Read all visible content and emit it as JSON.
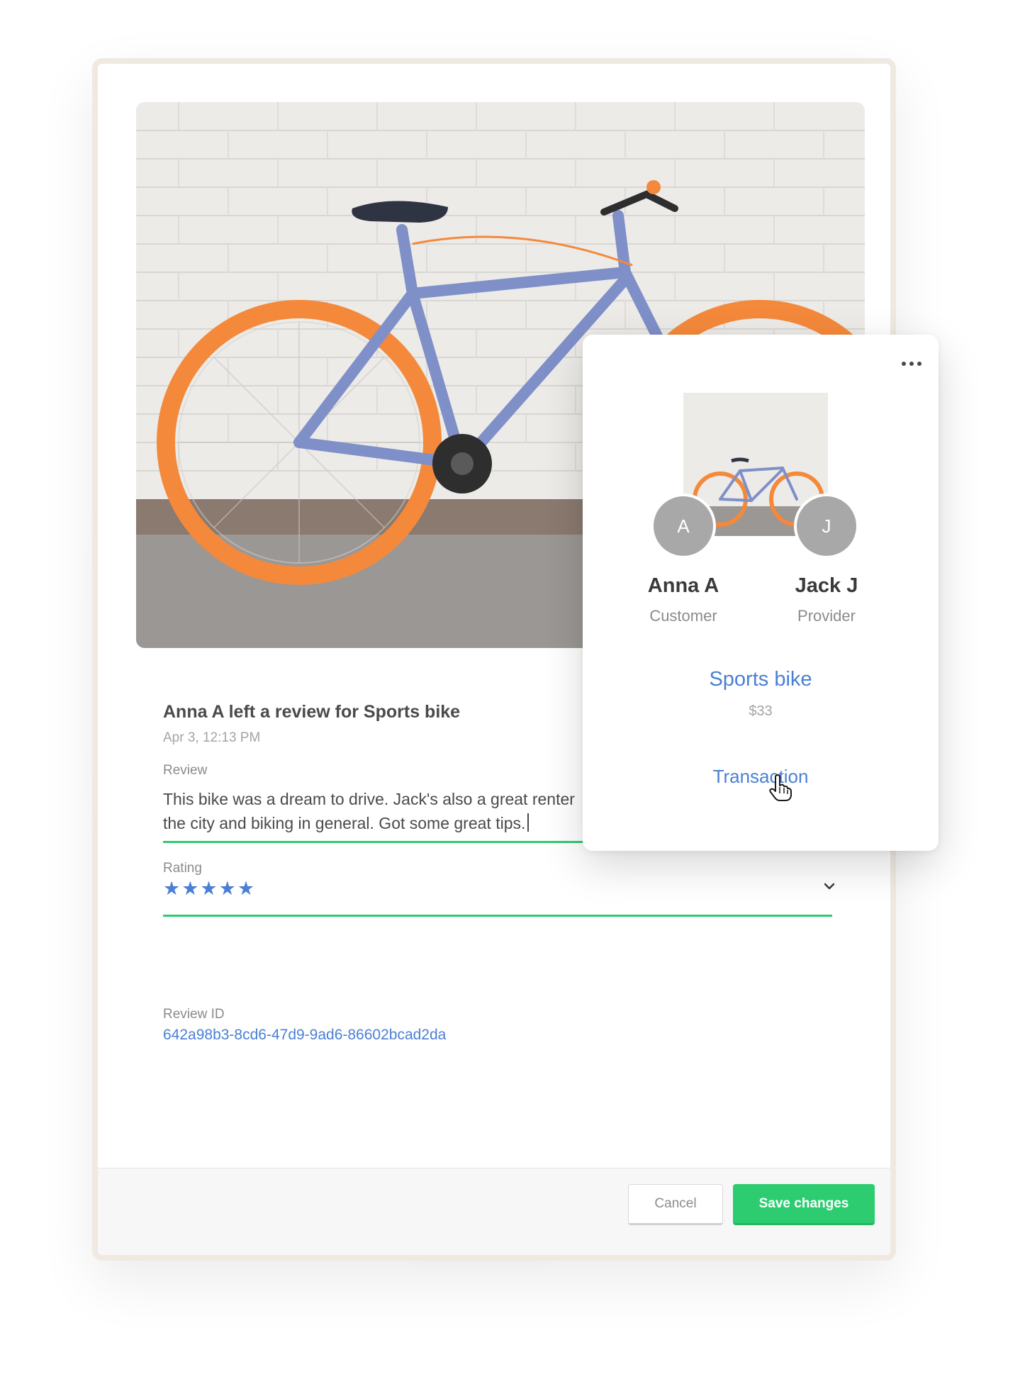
{
  "review": {
    "title": "Anna A left a review for Sports bike",
    "date": "Apr 3, 12:13 PM",
    "review_label": "Review",
    "review_text": "This bike was a dream to drive. Jack's also a great renter",
    "review_text_line2": "the city and biking in general. Got some great tips.",
    "rating_label": "Rating",
    "rating_stars": "★★★★★",
    "rating_value": 5,
    "review_id_label": "Review ID",
    "review_id": "642a98b3-8cd6-47d9-9ad6-86602bcad2da"
  },
  "footer": {
    "cancel_label": "Cancel",
    "save_label": "Save changes"
  },
  "popup": {
    "customer_initial": "A",
    "customer_name": "Anna A",
    "customer_role": "Customer",
    "provider_initial": "J",
    "provider_name": "Jack J",
    "provider_role": "Provider",
    "listing_name": "Sports bike",
    "listing_price": "$33",
    "transaction_label": "Transaction"
  },
  "colors": {
    "accent_blue": "#4a7fd6",
    "success_green": "#2ecc71",
    "avatar_gray": "#a8a8a8"
  },
  "icons": [
    "more-icon",
    "chevron-down-icon",
    "hand-cursor-icon",
    "star-icon"
  ]
}
